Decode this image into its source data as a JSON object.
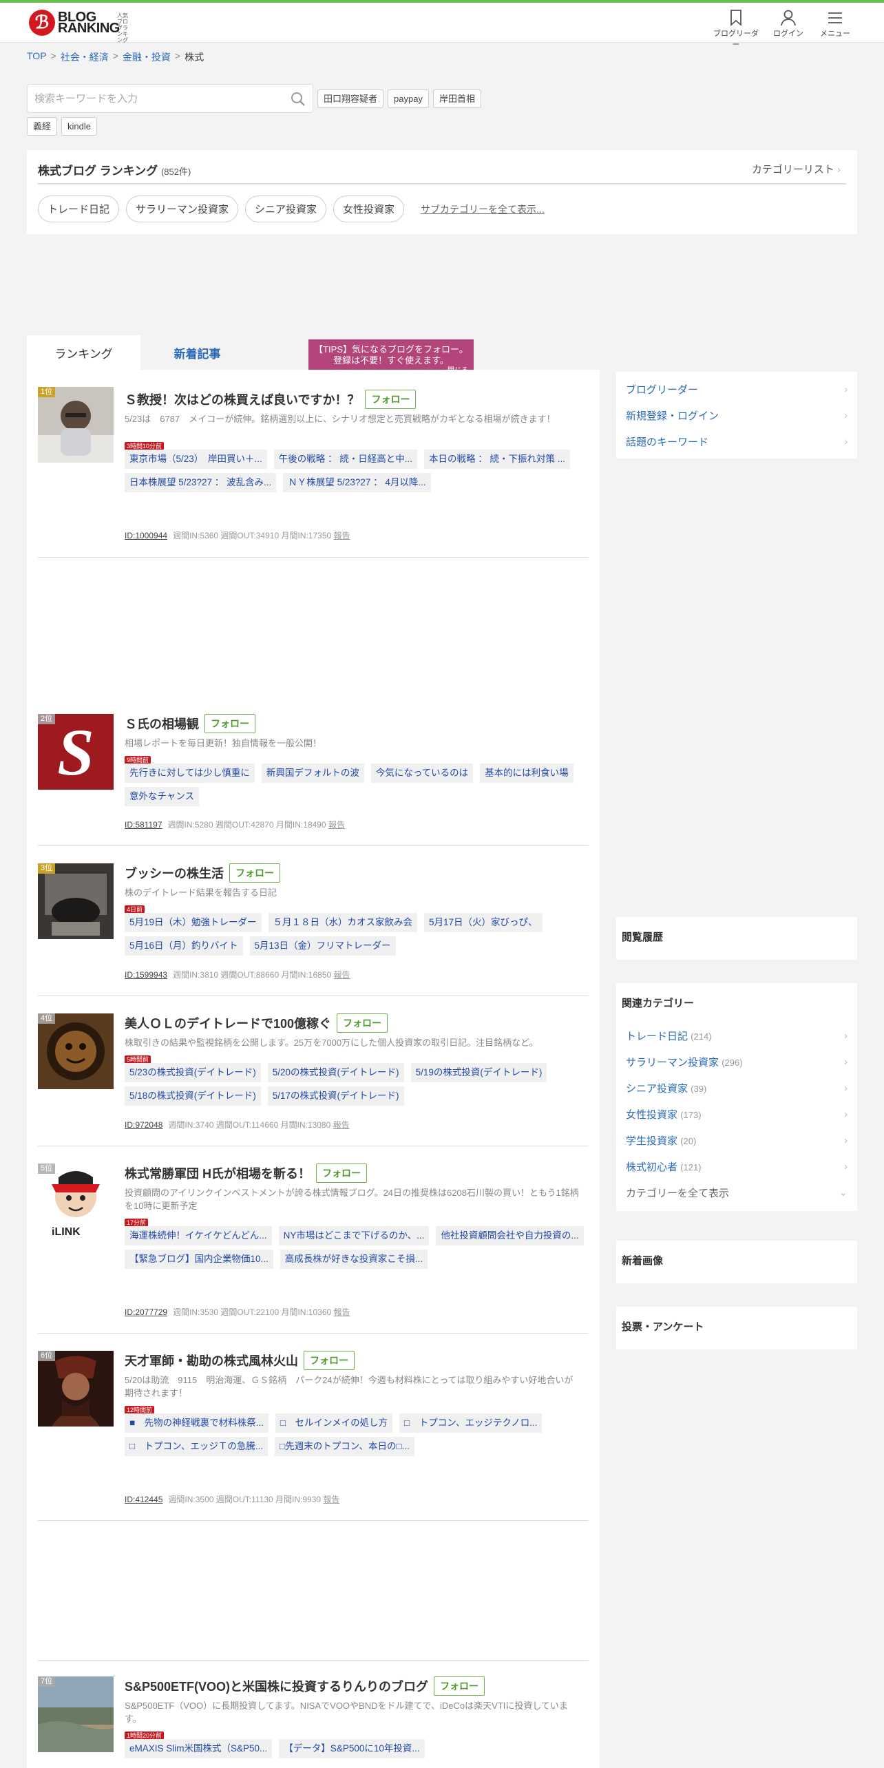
{
  "header": {
    "logo_text_1": "BLOG",
    "logo_text_2": "RANKING",
    "logo_sub": "人気ブログランキング",
    "nav": [
      {
        "label": "ブログリーダー",
        "icon": "bookmark-icon"
      },
      {
        "label": "ログイン",
        "icon": "user-icon"
      },
      {
        "label": "メニュー",
        "icon": "menu-icon"
      }
    ]
  },
  "breadcrumb": {
    "items": [
      "TOP",
      "社会・経済",
      "金融・投資"
    ],
    "sep": ">",
    "current": "株式"
  },
  "search": {
    "placeholder": "検索キーワードを入力",
    "keywords": [
      "田口翔容疑者",
      "paypay",
      "岸田首相",
      "義経",
      "kindle"
    ]
  },
  "category": {
    "title": "株式ブログ ランキング",
    "count": "(852件)",
    "category_list": "カテゴリーリスト",
    "subcats": [
      "トレード日記",
      "サラリーマン投資家",
      "シニア投資家",
      "女性投資家"
    ],
    "show_all": "サブカテゴリーを全て表示..."
  },
  "tabs": [
    "ランキング",
    "新着記事"
  ],
  "tips": {
    "line1": "【TIPS】気になるブログをフォロー。",
    "line2": "登録は不要！すぐ使えます。",
    "close": "閉じる"
  },
  "follow_label": "フォロー",
  "report_label": "報告",
  "entries": [
    {
      "rank": "1位",
      "title": "Ｓ教授！次はどの株買えば良いですか！？",
      "desc": "5/23は　6787　メイコーが続伸。銘柄選別以上に、シナリオ想定と売買戦略がカギとなる相場が続きます！",
      "new_badge": "3時間10分前",
      "articles": [
        "東京市場（5/23）　岸田買い＋...",
        "午後の戦略 ： 続・日経高と中...",
        "本日の戦略 ： 続・下振れ対策 ...",
        "日本株展望 5/23?27 ： 波乱含み...",
        "ＮＹ株展望 5/23?27 ： 4月以降..."
      ],
      "id": "ID:1000944",
      "stats": "週間IN:5360 週間OUT:34910 月間IN:17350"
    },
    {
      "rank": "2位",
      "title": "Ｓ氏の相場観",
      "desc": "相場レポートを毎日更新！独自情報を一般公開！",
      "new_badge": "9時間前",
      "articles": [
        "先行きに対しては少し慎重に",
        "新興国デフォルトの波",
        "今気になっているのは",
        "基本的には利食い場",
        "意外なチャンス"
      ],
      "id": "ID:581197",
      "stats": "週間IN:5280 週間OUT:42870 月間IN:18490"
    },
    {
      "rank": "3位",
      "title": "ブッシーの株生活",
      "desc": "株のデイトレード結果を報告する日記",
      "new_badge": "4日前",
      "articles": [
        "5月19日（木）勉強トレーダー",
        "５月１８日（水）カオス家飲み会",
        "5月17日（火）家びっぴ、",
        "5月16日（月）釣りバイト",
        "5月13日（金）フリマトレーダー"
      ],
      "id": "ID:1599943",
      "stats": "週間IN:3810 週間OUT:88660 月間IN:16850"
    },
    {
      "rank": "4位",
      "title": "美人ＯＬのデイトレードで100億稼ぐ",
      "desc": "株取引きの結果や監視銘柄を公開します。25万を7000万にした個人投資家の取引日記。注目銘柄など。",
      "new_badge": "5時間前",
      "articles": [
        "5/23の株式投資(デイトレード)",
        "5/20の株式投資(デイトレード)",
        "5/19の株式投資(デイトレード)",
        "5/18の株式投資(デイトレード)",
        "5/17の株式投資(デイトレード)"
      ],
      "id": "ID:972048",
      "stats": "週間IN:3740 週間OUT:114660 月間IN:13080"
    },
    {
      "rank": "5位",
      "title": "株式常勝軍団 H氏が相場を斬る！",
      "desc": "投資顧問のアイリンクインベストメントが誇る株式情報ブログ。24日の推奨株は6208石川製の買い！ともう1銘柄を10時に更新予定",
      "new_badge": "17分前",
      "articles": [
        "海運株続伸！イケイケどんどん...",
        "NY市場はどこまで下げるのか、...",
        "他社投資顧問会社や自力投資の...",
        "【緊急ブログ】国内企業物価10...",
        "高成長株が好きな投資家こそ損..."
      ],
      "id": "ID:2077729",
      "stats": "週間IN:3530 週間OUT:22100 月間IN:10360"
    },
    {
      "rank": "6位",
      "title": "天才軍師・勘助の株式風林火山",
      "desc": "5/20は助流　9115　明治海運、ＧＳ銘柄　パーク24が続伸！今週も材料株にとっては取り組みやすい好地合いが期待されます！",
      "new_badge": "12時間前",
      "articles": [
        "■　先物の神経戦裏で材料株祭...",
        "□　セルインメイの処し方",
        "□　トプコン、エッジテクノロ...",
        "□　トプコン、エッジＴの急騰...",
        "□先週末のトプコン、本日の□..."
      ],
      "id": "ID:412445",
      "stats": "週間IN:3500 週間OUT:11130 月間IN:9930"
    },
    {
      "rank": "7位",
      "title": "S&P500ETF(VOO)と米国株に投資するりんりのブログ",
      "desc": "S&P500ETF（VOO）に長期投資してます。NISAでVOOやBNDをドル建てで、iDeCoは楽天VTIに投資しています。",
      "new_badge": "1時間20分前",
      "articles": [
        "eMAXIS Slim米国株式（S&P50...",
        "【データ】S&P500に10年投資..."
      ],
      "id": "",
      "stats": ""
    }
  ],
  "sidebar": {
    "links": [
      "ブログリーダー",
      "新規登録・ログイン",
      "話題のキーワード"
    ],
    "history_title": "閲覧履歴",
    "related_title": "関連カテゴリー",
    "related": [
      {
        "name": "トレード日記",
        "count": "(214)"
      },
      {
        "name": "サラリーマン投資家",
        "count": "(296)"
      },
      {
        "name": "シニア投資家",
        "count": "(39)"
      },
      {
        "name": "女性投資家",
        "count": "(173)"
      },
      {
        "name": "学生投資家",
        "count": "(20)"
      },
      {
        "name": "株式初心者",
        "count": "(121)"
      }
    ],
    "show_all_categories": "カテゴリーを全て表示",
    "new_images_title": "新着画像",
    "vote_title": "投票・アンケート"
  },
  "colors": {
    "accent_green": "#6bc04b",
    "link_blue": "#2a6ab8",
    "tips_bg": "#b3457a",
    "brand_red": "#d4181f"
  }
}
